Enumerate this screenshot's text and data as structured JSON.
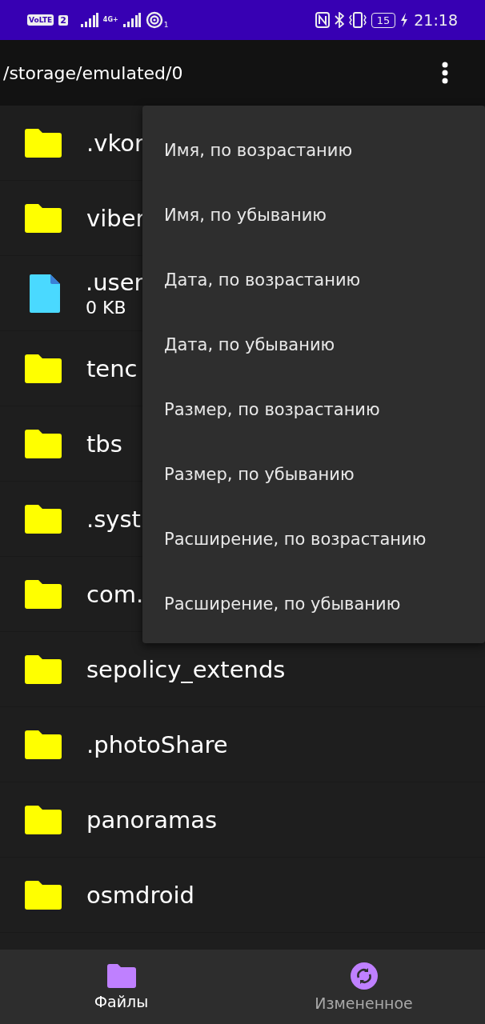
{
  "status_bar": {
    "volte": "VoLTE",
    "sim": "2",
    "network": "4G+",
    "hotspot_count": "1",
    "battery": "15",
    "charging": true,
    "time": "21:18"
  },
  "toolbar": {
    "path": "/storage/emulated/0"
  },
  "files": [
    {
      "kind": "folder",
      "name": ".vkor"
    },
    {
      "kind": "folder",
      "name": "viber"
    },
    {
      "kind": "file",
      "name": ".user",
      "size": "0 KB"
    },
    {
      "kind": "folder",
      "name": "tenc"
    },
    {
      "kind": "folder",
      "name": "tbs"
    },
    {
      "kind": "folder",
      "name": ".syst"
    },
    {
      "kind": "folder",
      "name": "com."
    },
    {
      "kind": "folder",
      "name": "sepolicy_extends"
    },
    {
      "kind": "folder",
      "name": ".photoShare"
    },
    {
      "kind": "folder",
      "name": "panoramas"
    },
    {
      "kind": "folder",
      "name": "osmdroid"
    }
  ],
  "sort_menu": {
    "items": [
      "Имя, по возрастанию",
      "Имя, по убыванию",
      "Дата, по возрастанию",
      "Дата, по убыванию",
      "Размер, по возрастанию",
      "Размер, по убыванию",
      "Расширение, по возрастанию",
      "Расширение, по убыванию"
    ]
  },
  "bottom_nav": [
    {
      "kind": "folder",
      "label": "Файлы",
      "selected": true
    },
    {
      "kind": "sync",
      "label": "Измененное",
      "selected": false
    }
  ]
}
